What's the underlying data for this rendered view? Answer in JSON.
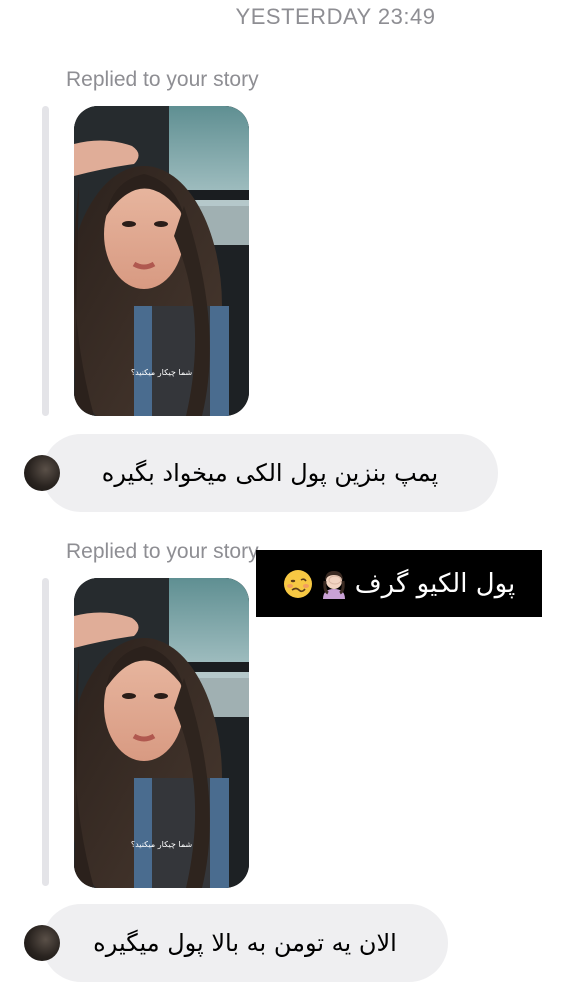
{
  "chat": {
    "timestamp": "YESTERDAY 23:49",
    "messages": [
      {
        "reply_label": "Replied to your story",
        "story_caption": "شما چیکار میکنید؟",
        "text": "پمپ بنزین پول الکی میخواد بگیره"
      },
      {
        "reply_label": "Replied to your story",
        "story_caption": "شما چیکار میکنید؟",
        "text": "الان یه تومن به بالا پول میگیره"
      }
    ]
  },
  "overlay": {
    "text": "پول الکیو گرف"
  },
  "colors": {
    "bubble": "#efeff1",
    "meta_text": "#8e8e93",
    "quote_line": "#e4e4e8",
    "overlay_bg": "#000000"
  },
  "icons": {
    "overlay_emoji_1": "woozy-face-icon",
    "overlay_emoji_2": "woman-facepalming-icon"
  }
}
